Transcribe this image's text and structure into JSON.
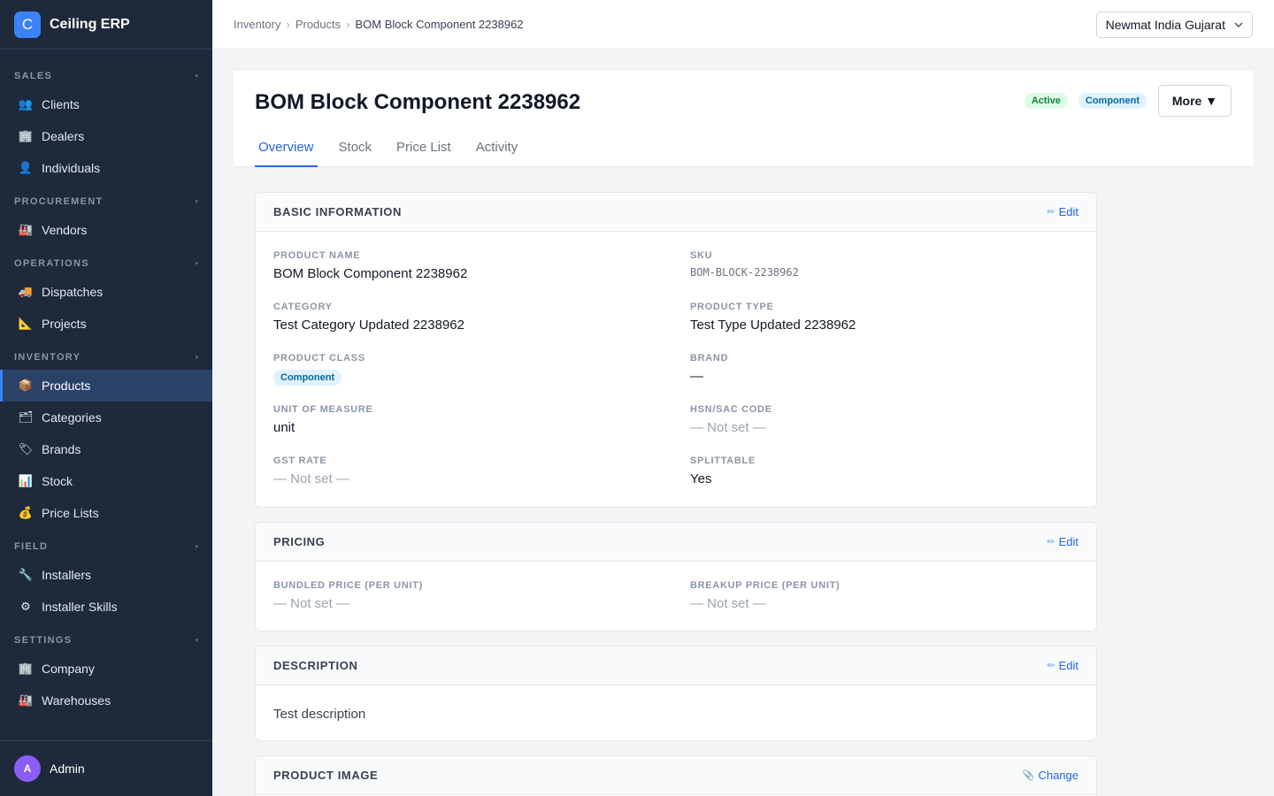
{
  "app": {
    "name": "Ceiling ERP",
    "logo_letter": "C"
  },
  "sidebar": {
    "sections": [
      {
        "title": "SALES",
        "items": [
          {
            "label": "Clients",
            "icon": "👥",
            "icon_name": "clients-icon"
          },
          {
            "label": "Dealers",
            "icon": "🏢",
            "icon_name": "dealers-icon"
          },
          {
            "label": "Individuals",
            "icon": "👤",
            "icon_name": "individuals-icon"
          }
        ]
      },
      {
        "title": "PROCUREMENT",
        "items": [
          {
            "label": "Vendors",
            "icon": "🏭",
            "icon_name": "vendors-icon"
          }
        ]
      },
      {
        "title": "OPERATIONS",
        "items": [
          {
            "label": "Dispatches",
            "icon": "🚚",
            "icon_name": "dispatches-icon"
          },
          {
            "label": "Projects",
            "icon": "📐",
            "icon_name": "projects-icon"
          }
        ]
      },
      {
        "title": "INVENTORY",
        "items": [
          {
            "label": "Products",
            "icon": "📦",
            "icon_name": "products-icon",
            "active": true
          },
          {
            "label": "Categories",
            "icon": "🗂",
            "icon_name": "categories-icon"
          },
          {
            "label": "Brands",
            "icon": "🏷",
            "icon_name": "brands-icon"
          },
          {
            "label": "Stock",
            "icon": "📊",
            "icon_name": "stock-icon"
          },
          {
            "label": "Price Lists",
            "icon": "💰",
            "icon_name": "price-lists-icon"
          }
        ]
      },
      {
        "title": "FIELD",
        "items": [
          {
            "label": "Installers",
            "icon": "🔧",
            "icon_name": "installers-icon"
          },
          {
            "label": "Installer Skills",
            "icon": "⚙",
            "icon_name": "installer-skills-icon"
          }
        ]
      },
      {
        "title": "SETTINGS",
        "items": [
          {
            "label": "Company",
            "icon": "🏢",
            "icon_name": "company-icon"
          },
          {
            "label": "Warehouses",
            "icon": "🏭",
            "icon_name": "warehouses-icon"
          }
        ]
      }
    ],
    "user": {
      "initial": "A",
      "name": "Admin"
    }
  },
  "topbar": {
    "breadcrumb": [
      "Inventory",
      "Products",
      "BOM Block Component 2238962"
    ],
    "breadcrumb_sep": "›",
    "org": "Newmat India Gujarat"
  },
  "page": {
    "title": "BOM Block Component 2238962",
    "badges": [
      "Active",
      "Component"
    ],
    "more_label": "More ▼",
    "tabs": [
      "Overview",
      "Stock",
      "Price List",
      "Activity"
    ],
    "active_tab": "Overview"
  },
  "basic_info": {
    "title": "BASIC INFORMATION",
    "edit_label": "Edit",
    "fields": [
      {
        "label": "PRODUCT NAME",
        "value": "BOM Block Component 2238962",
        "style": "normal"
      },
      {
        "label": "SKU",
        "value": "BOM-BLOCK-2238962",
        "style": "mono"
      },
      {
        "label": "CATEGORY",
        "value": "Test Category Updated 2238962",
        "style": "normal"
      },
      {
        "label": "PRODUCT TYPE",
        "value": "Test Type Updated 2238962",
        "style": "normal"
      },
      {
        "label": "PRODUCT CLASS",
        "value": "Component",
        "style": "badge"
      },
      {
        "label": "BRAND",
        "value": "—",
        "style": "normal"
      },
      {
        "label": "UNIT OF MEASURE",
        "value": "unit",
        "style": "normal"
      },
      {
        "label": "HSN/SAC CODE",
        "value": "— Not set —",
        "style": "muted"
      },
      {
        "label": "GST RATE",
        "value": "— Not set —",
        "style": "muted"
      },
      {
        "label": "SPLITTABLE",
        "value": "Yes",
        "style": "normal"
      }
    ]
  },
  "pricing": {
    "title": "PRICING",
    "edit_label": "Edit",
    "fields": [
      {
        "label": "BUNDLED PRICE (PER UNIT)",
        "value": "— Not set —",
        "style": "muted"
      },
      {
        "label": "BREAKUP PRICE (PER UNIT)",
        "value": "— Not set —",
        "style": "muted"
      }
    ]
  },
  "description": {
    "title": "DESCRIPTION",
    "edit_label": "Edit",
    "text": "Test description"
  },
  "product_image": {
    "title": "PRODUCT IMAGE",
    "change_label": "Change"
  }
}
